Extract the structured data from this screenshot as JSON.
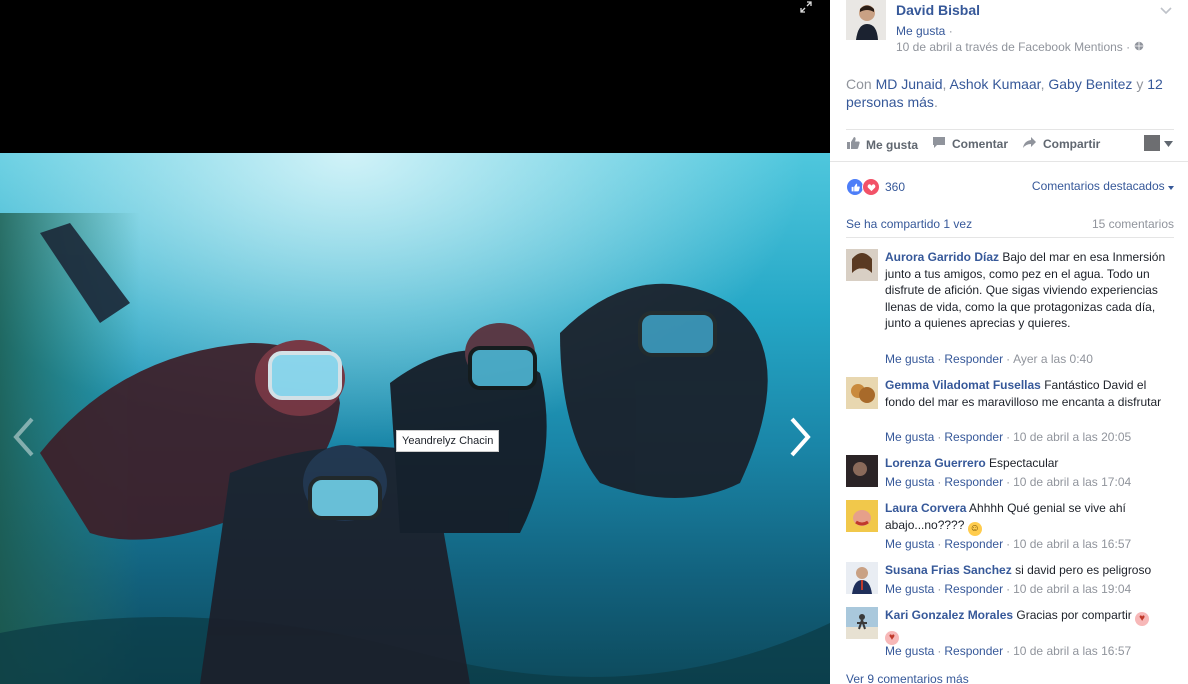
{
  "viewer": {
    "tag_name": "Yeandrelyz Chacin",
    "expand_icon": "expand-icon",
    "prev_icon": "chevron-left-icon",
    "next_icon": "chevron-right-icon"
  },
  "post": {
    "author": "David Bisbal",
    "like_label": "Me gusta",
    "like_dot": "·",
    "meta": "10 de abril a través de Facebook Mentions",
    "meta_dot": "·",
    "with_prefix": "Con",
    "tagged": [
      "MD Junaid",
      "Ashok Kumaar",
      "Gaby Benitez"
    ],
    "with_and": "y",
    "others": "12 personas más",
    "period": "."
  },
  "actions": {
    "like": "Me gusta",
    "comment": "Comentar",
    "share": "Compartir"
  },
  "reactions": {
    "count": "360",
    "top_comments": "Comentarios destacados",
    "shared": "Se ha compartido 1 vez",
    "comments_count": "15 comentarios"
  },
  "comments": [
    {
      "author": "Aurora Garrido Díaz",
      "text": "Bajo del mar en esa Inmersión junto a tus amigos, como pez en el agua. Todo un disfrute de afición. Que sigas viviendo experiencias llenas de vida, como la que protagonizas cada día, junto a quienes aprecias y quieres.",
      "like": "Me gusta",
      "reply": "Responder",
      "time": "Ayer a las 0:40",
      "avatar_color": "#8a6a4a"
    },
    {
      "author": "Gemma Viladomat Fusellas",
      "text": "Fantástico David el fondo del mar es maravilloso me encanta a disfrutar",
      "like": "Me gusta",
      "reply": "Responder",
      "time": "10 de abril a las 20:05",
      "avatar_color": "#c98a3d"
    },
    {
      "author": "Lorenza Guerrero",
      "text": "Espectacular",
      "like": "Me gusta",
      "reply": "Responder",
      "time": "10 de abril a las 17:04",
      "avatar_color": "#3a2f2f"
    },
    {
      "author": "Laura Corvera",
      "text": "Ahhhh Qué genial se vive ahí abajo...no????",
      "like": "Me gusta",
      "reply": "Responder",
      "time": "10 de abril a las 16:57",
      "avatar_color": "#d9a441"
    },
    {
      "author": "Susana Frias Sanchez",
      "text": "si david pero es peligroso",
      "like": "Me gusta",
      "reply": "Responder",
      "time": "10 de abril a las 19:04",
      "avatar_color": "#2f4f8f"
    },
    {
      "author": "Kari Gonzalez Morales",
      "text": "Gracias por compartir",
      "like": "Me gusta",
      "reply": "Responder",
      "time": "10 de abril a las 16:57",
      "avatar_color": "#5b8fb0"
    }
  ],
  "more_comments": "Ver 9 comentarios más",
  "colors": {
    "link": "#365899",
    "muted": "#90949c",
    "like_react": "#4d7ef8",
    "love_react": "#f25268"
  }
}
